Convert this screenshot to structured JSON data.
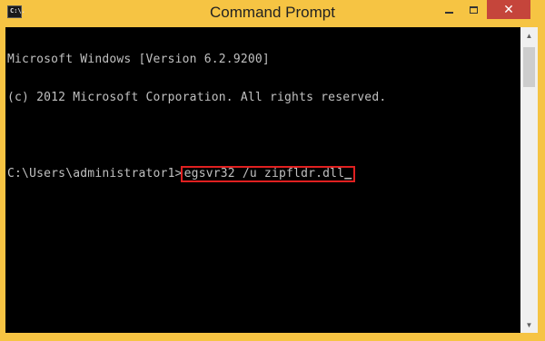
{
  "window": {
    "title": "Command Prompt",
    "icon_text": "C:\\."
  },
  "controls": {
    "minimize": "minimize-icon",
    "maximize": "maximize-icon",
    "close": "close-icon"
  },
  "console": {
    "lines": [
      "Microsoft Windows [Version 6.2.9200]",
      "(c) 2012 Microsoft Corporation. All rights reserved.",
      ""
    ],
    "prompt": "C:\\Users\\administrator1>",
    "command": "egsvr32 /u zipfldr.dll",
    "cursor": "_",
    "highlight_color": "#e02020"
  }
}
